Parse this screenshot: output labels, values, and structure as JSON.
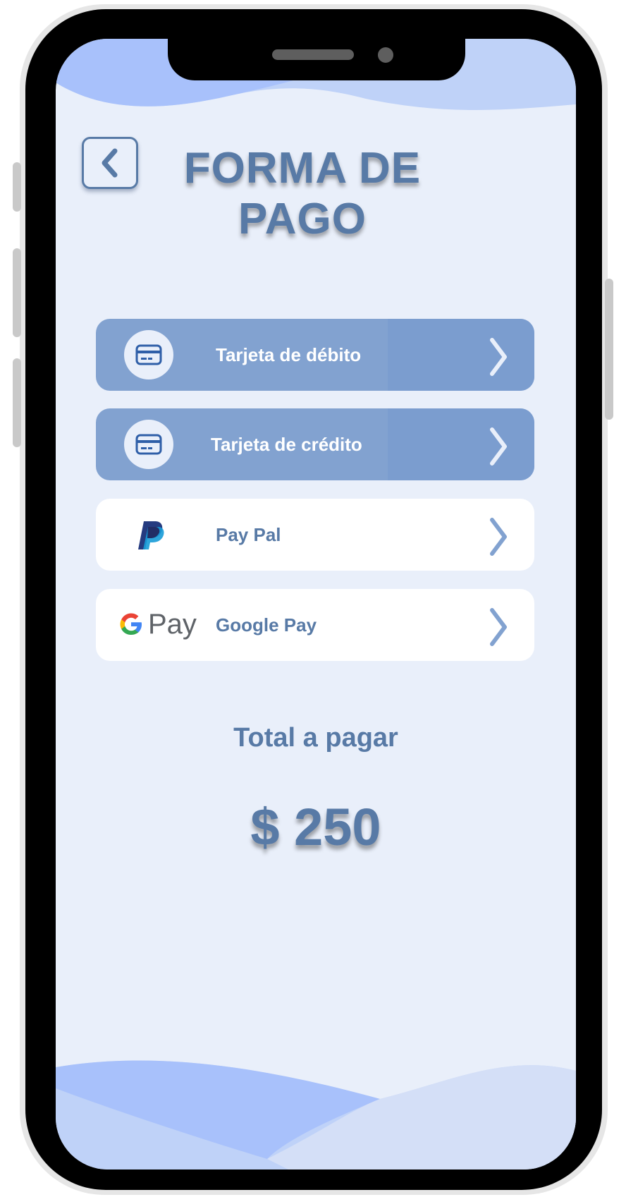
{
  "header": {
    "title": "FORMA DE PAGO"
  },
  "payment_options": [
    {
      "label": "Tarjeta de débito",
      "icon": "credit-card-icon",
      "style": "blue"
    },
    {
      "label": "Tarjeta de crédito",
      "icon": "credit-card-icon",
      "style": "blue"
    },
    {
      "label": "Pay Pal",
      "icon": "paypal-logo-icon",
      "style": "white"
    },
    {
      "label": "Google Pay",
      "icon": "google-pay-logo-icon",
      "style": "white",
      "logo_text": "Pay"
    }
  ],
  "total": {
    "label": "Total a pagar",
    "amount": "$ 250"
  },
  "colors": {
    "accent": "#587aa6",
    "option_blue": "#82a2d0",
    "screen_bg": "#e9effa",
    "wave_light": "#bfd2f8",
    "wave_mid": "#a8c1fb"
  }
}
